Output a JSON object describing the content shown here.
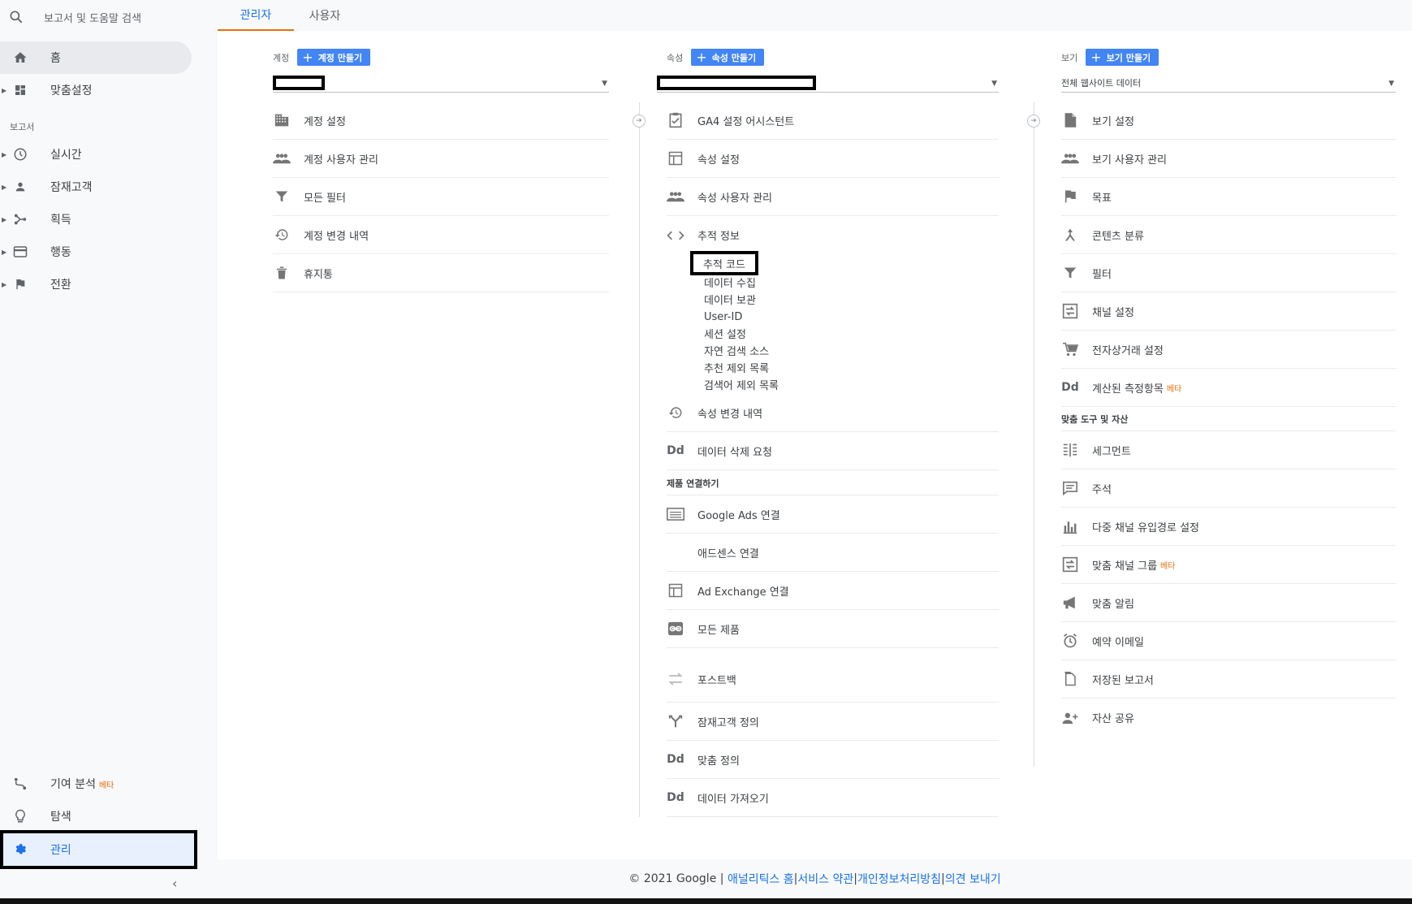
{
  "search": {
    "placeholder": "보고서 및 도움말 검색"
  },
  "nav": {
    "home": "홈",
    "customization": "맞춤설정",
    "reports_label": "보고서",
    "realtime": "실시간",
    "audience": "잠재고객",
    "acquisition": "획득",
    "behavior": "행동",
    "conversions": "전환",
    "attribution": "기여 분석",
    "attribution_badge": "베타",
    "discover": "탐색",
    "admin": "관리"
  },
  "tabs": {
    "admin": "관리자",
    "user": "사용자"
  },
  "account": {
    "label": "계정",
    "create": "계정 만들기",
    "items": [
      "계정 설정",
      "계정 사용자 관리",
      "모든 필터",
      "계정 변경 내역",
      "휴지통"
    ]
  },
  "property": {
    "label": "속성",
    "create": "속성 만들기",
    "items": [
      "GA4 설정 어시스턴트",
      "속성 설정",
      "속성 사용자 관리",
      "추적 정보"
    ],
    "tracking_sub": [
      "추적 코드",
      "데이터 수집",
      "데이터 보관",
      "User-ID",
      "세션 설정",
      "자연 검색 소스",
      "추천 제외 목록",
      "검색어 제외 목록"
    ],
    "items2": [
      "속성 변경 내역",
      "데이터 삭제 요청"
    ],
    "product_linking_label": "제품 연결하기",
    "links": [
      "Google Ads 연결",
      "애드센스 연결",
      "Ad Exchange 연결",
      "모든 제품"
    ],
    "items3": [
      "포스트백",
      "잠재고객 정의",
      "맞춤 정의",
      "데이터 가져오기"
    ]
  },
  "view": {
    "label": "보기",
    "create": "보기 만들기",
    "selected": "전체 웹사이트 데이터",
    "items": [
      "보기 설정",
      "보기 사용자 관리",
      "목표",
      "콘텐츠 분류",
      "필터",
      "채널 설정",
      "전자상거래 설정",
      "계산된 측정항목"
    ],
    "calc_badge": "베타",
    "tools_label": "맞춤 도구 및 자산",
    "tools": [
      "세그먼트",
      "주석",
      "다중 채널 유입경로 설정",
      "맞춤 채널 그룹",
      "맞춤 알림",
      "예약 이메일",
      "저장된 보고서",
      "자산 공유"
    ],
    "channel_badge": "베타"
  },
  "footer": {
    "copyright": "© 2021 Google | ",
    "home": "애널리틱스 홈",
    "sep": " | ",
    "terms": "서비스 약관",
    "privacy": "개인정보처리방침",
    "feedback": "의견 보내기"
  }
}
